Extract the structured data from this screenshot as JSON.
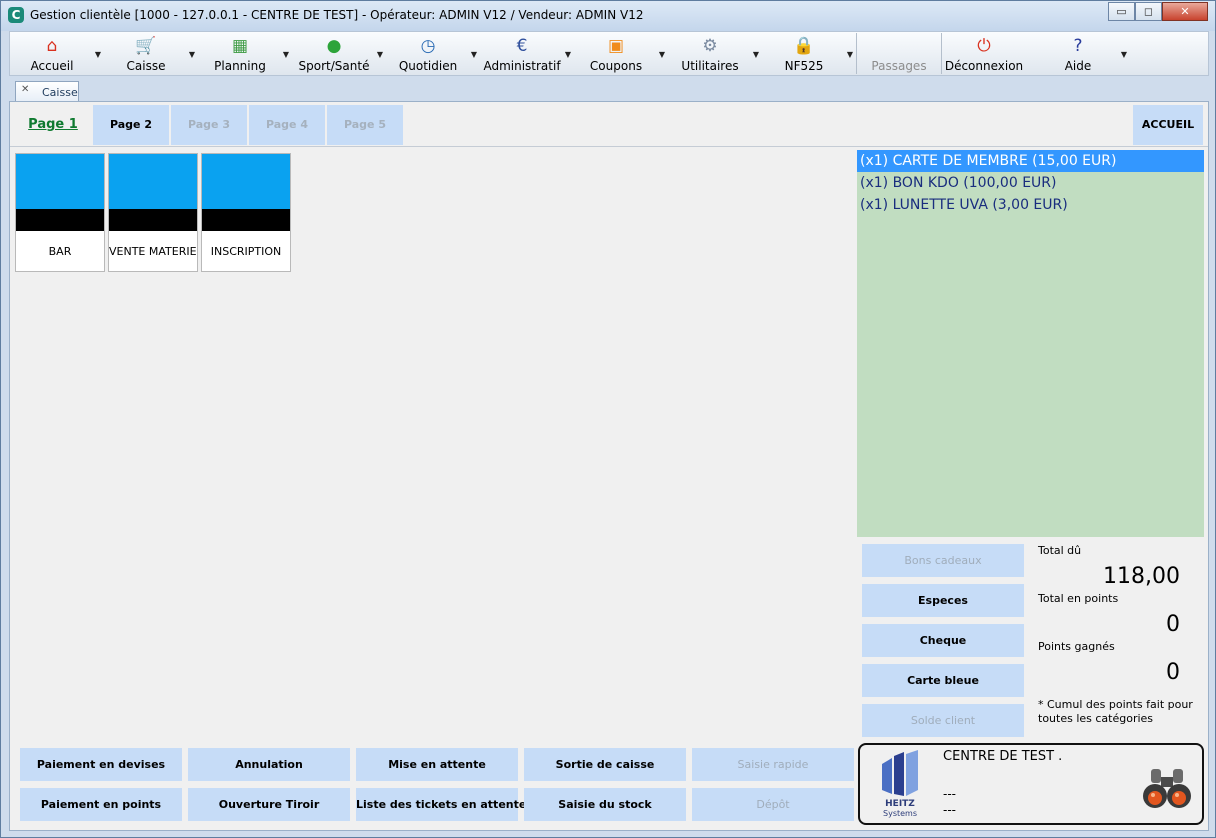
{
  "window": {
    "title": "Gestion clientèle [1000 - 127.0.0.1 - CENTRE DE TEST] - Opérateur: ADMIN V12 / Vendeur: ADMIN V12",
    "minimize": "▭",
    "maximize": "◻",
    "close": "✕"
  },
  "toolbar": {
    "items": [
      {
        "label": "Accueil",
        "icon": "home-icon",
        "glyph": "⌂",
        "color": "#d9311f"
      },
      {
        "label": "Caisse",
        "icon": "cart-icon",
        "glyph": "🛒",
        "color": "#8cae3a"
      },
      {
        "label": "Planning",
        "icon": "calendar-icon",
        "glyph": "▦",
        "color": "#3f9c45"
      },
      {
        "label": "Sport/Santé",
        "icon": "runner-icon",
        "glyph": "●",
        "color": "#2da43a"
      },
      {
        "label": "Quotidien",
        "icon": "clock-icon",
        "glyph": "◷",
        "color": "#2a6bb4"
      },
      {
        "label": "Administratif",
        "icon": "euro-icon",
        "glyph": "€",
        "color": "#2f4f9c"
      },
      {
        "label": "Coupons",
        "icon": "gift-icon",
        "glyph": "▣",
        "color": "#f08c1c"
      },
      {
        "label": "Utilitaires",
        "icon": "gear-icon",
        "glyph": "⚙",
        "color": "#7a8aa0"
      },
      {
        "label": "NF525",
        "icon": "lock-icon",
        "glyph": "🔒",
        "color": "#9a9a9a"
      }
    ],
    "passages": "Passages",
    "deconnexion": {
      "label": "Déconnexion",
      "icon": "power-icon",
      "glyph": "⏻",
      "color": "#d9311f"
    },
    "aide": {
      "label": "Aide",
      "icon": "help-icon",
      "glyph": "?",
      "color": "#2a3d9c"
    },
    "dropdown_arrow": "▼"
  },
  "doc_tab": {
    "label": "Caisse",
    "close": "✕"
  },
  "pages": {
    "tabs": [
      {
        "label": "Page 1",
        "state": "active"
      },
      {
        "label": "Page 2",
        "state": "normal"
      },
      {
        "label": "Page 3",
        "state": "disabled"
      },
      {
        "label": "Page 4",
        "state": "disabled"
      },
      {
        "label": "Page 5",
        "state": "disabled"
      }
    ],
    "accueil": "ACCUEIL"
  },
  "categories": [
    "BAR",
    "VENTE MATERIEL",
    "INSCRIPTION"
  ],
  "ticket": {
    "lines": [
      "(x1) CARTE DE MEMBRE (15,00 EUR)",
      "(x1) BON KDO (100,00 EUR)",
      "(x1) LUNETTE UVA (3,00 EUR)"
    ],
    "selected_index": 0
  },
  "payments": [
    {
      "label": "Bons cadeaux",
      "enabled": false
    },
    {
      "label": "Especes",
      "enabled": true
    },
    {
      "label": "Cheque",
      "enabled": true
    },
    {
      "label": "Carte bleue",
      "enabled": true
    },
    {
      "label": "Solde client",
      "enabled": false
    }
  ],
  "totals": {
    "total_du_label": "Total dû",
    "total_du": "118,00",
    "total_points_label": "Total en points",
    "total_points": "0",
    "points_gagnes_label": "Points gagnés",
    "points_gagnes": "0",
    "note": "* Cumul des points fait pour toutes les catégories"
  },
  "actions": {
    "row1": [
      {
        "label": "Paiement en devises",
        "enabled": true
      },
      {
        "label": "Annulation",
        "enabled": true
      },
      {
        "label": "Mise en attente",
        "enabled": true
      },
      {
        "label": "Sortie de caisse",
        "enabled": true
      },
      {
        "label": "Saisie rapide",
        "enabled": false
      }
    ],
    "row2": [
      {
        "label": "Paiement en points",
        "enabled": true
      },
      {
        "label": "Ouverture Tiroir",
        "enabled": true
      },
      {
        "label": "Liste des tickets en attente",
        "enabled": true
      },
      {
        "label": "Saisie du stock",
        "enabled": true
      },
      {
        "label": "Dépôt",
        "enabled": false
      }
    ]
  },
  "info": {
    "title": "CENTRE DE TEST .",
    "line1": "---",
    "line2": "---",
    "logo_text": "HEITZ",
    "logo_sub": "Systems",
    "search_icon": "binoculars-icon"
  }
}
